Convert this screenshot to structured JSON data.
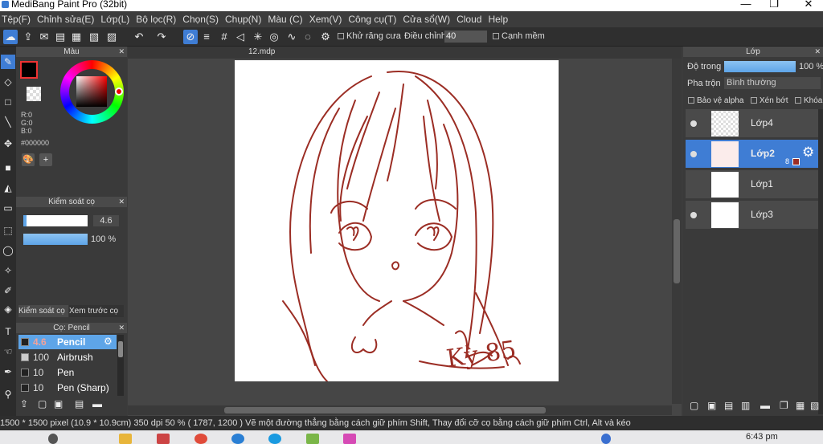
{
  "window": {
    "title": "MediBang Paint Pro (32bit)",
    "minimize_glyph": "—",
    "maximize_glyph": "❐",
    "close_glyph": "✕"
  },
  "menu": [
    "Tệp(F)",
    "Chỉnh sửa(E)",
    "Lớp(L)",
    "Bộ lọc(R)",
    "Chọn(S)",
    "Chụp(N)",
    "Màu (C)",
    "Xem(V)",
    "Công cụ(T)",
    "Cửa sổ(W)",
    "Cloud",
    "Help"
  ],
  "toolbar": {
    "antialias_label": "Khử răng cưa",
    "correction_label": "Điều chỉnh",
    "correction_value": "40",
    "edge_label": "Cạnh mềm"
  },
  "color_panel": {
    "title": "Màu",
    "r": "R:0",
    "g": "G:0",
    "b": "B:0",
    "hex": "#000000"
  },
  "brush_control": {
    "title": "Kiểm soát cọ",
    "size_value": "4.6",
    "opacity_value": "100 %",
    "size_fraction": 0.05,
    "opacity_fraction": 1.0,
    "tab_control": "Kiểm soát cọ",
    "tab_preview": "Xem trước cọ"
  },
  "brush_list": {
    "title": "Cọ: Pencil",
    "items": [
      {
        "size": "4.6",
        "name": "Pencil",
        "selected": true
      },
      {
        "size": "100",
        "name": "Airbrush",
        "selected": false
      },
      {
        "size": "10",
        "name": "Pen",
        "selected": false
      },
      {
        "size": "10",
        "name": "Pen (Sharp)",
        "selected": false
      }
    ]
  },
  "document": {
    "tab_name": "12.mdp",
    "signature": "Kỳ 85"
  },
  "layer_panel": {
    "title": "Lớp",
    "opacity_label": "Độ trong",
    "opacity_value": "100 %",
    "opacity_fraction": 1.0,
    "blend_label": "Pha trộn",
    "blend_value": "Bình thường",
    "protect_alpha": "Bảo vệ alpha",
    "clipping": "Xén bớt",
    "lock": "Khóa",
    "layers": [
      {
        "name": "Lớp4",
        "selected": false,
        "visible": true
      },
      {
        "name": "Lớp2",
        "selected": true,
        "visible": true,
        "badge": "8"
      },
      {
        "name": "Lớp1",
        "selected": false,
        "visible": false
      },
      {
        "name": "Lớp3",
        "selected": false,
        "visible": true
      }
    ]
  },
  "status": {
    "text": "1500 * 1500 pixel   (10.9 * 10.9cm)   350 dpi   50 %   ( 1787, 1200 )   Vẽ một đường thẳng bằng cách giữ phím Shift, Thay đổi cỡ cọ bằng cách giữ phím Ctrl, Alt và kéo"
  },
  "taskbar": {
    "clock": "6:43 pm"
  },
  "colors": {
    "accent": "#3f7dd4",
    "line_art": "#9b2d24",
    "foreground": "#000000"
  }
}
